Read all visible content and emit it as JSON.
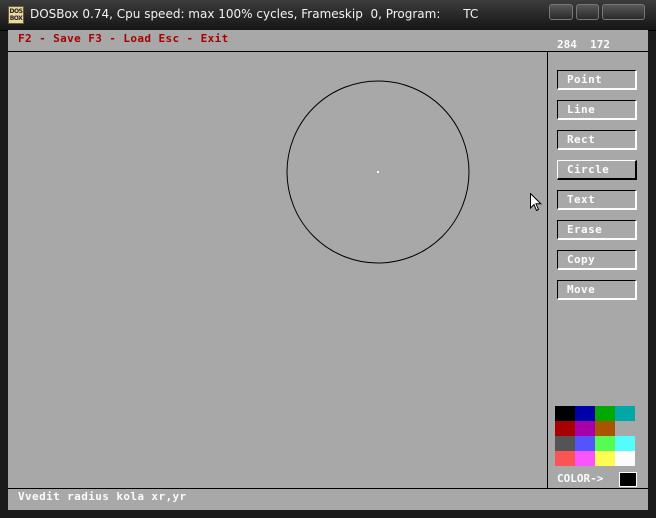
{
  "window": {
    "title": "DOSBox 0.74, Cpu speed: max 100% cycles, Frameskip  0, Program:      TC",
    "icon_text": [
      "DOS",
      "BOX"
    ]
  },
  "header": {
    "help_text": "F2 - Save F3 - Load Esc - Exit",
    "coords": "284  172"
  },
  "tools": [
    {
      "label": "Point"
    },
    {
      "label": "Line"
    },
    {
      "label": "Rect"
    },
    {
      "label": "Circle",
      "active": true
    },
    {
      "label": "Text"
    },
    {
      "label": "Erase"
    },
    {
      "label": "Copy"
    },
    {
      "label": "Move"
    }
  ],
  "palette": {
    "colors": [
      "#000000",
      "#0000a8",
      "#00a800",
      "#00a8a8",
      "#a80000",
      "#a800a8",
      "#a85400",
      "#a8a8a8",
      "#545454",
      "#5454fc",
      "#54fc54",
      "#54fcfc",
      "#fc5454",
      "#fc54fc",
      "#fcfc54",
      "#fcfcfc"
    ],
    "label": "COLOR->",
    "current": "#000000"
  },
  "canvas": {
    "shape": "circle",
    "stroke": "#000000",
    "background": "#a8a8a8"
  },
  "status": {
    "prompt": "Vvedit radius kola xr,yr"
  }
}
